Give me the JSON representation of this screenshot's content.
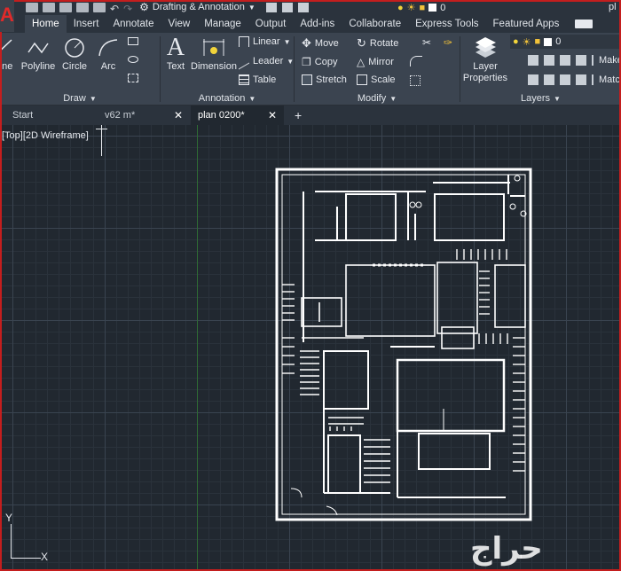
{
  "app": {
    "logo": "A"
  },
  "quick_access": {
    "workspace": "Drafting & Annotation",
    "layer_value": "0",
    "search_abbrev": "pl"
  },
  "ribbon_tabs": [
    "Home",
    "Insert",
    "Annotate",
    "View",
    "Manage",
    "Output",
    "Add-ins",
    "Collaborate",
    "Express Tools",
    "Featured Apps"
  ],
  "panels": {
    "draw": {
      "title": "Draw",
      "tools": [
        "Line",
        "Polyline",
        "Circle",
        "Arc"
      ]
    },
    "annotation": {
      "title": "Annotation",
      "tools": [
        "Text",
        "Dimension"
      ],
      "small": [
        "Linear",
        "Leader",
        "Table"
      ]
    },
    "modify": {
      "title": "Modify",
      "col1": [
        "Move",
        "Copy",
        "Stretch"
      ],
      "col2": [
        "Rotate",
        "Mirror",
        "Scale"
      ]
    },
    "layers": {
      "title": "Layers",
      "tool": "Layer Properties",
      "layer_name": "0",
      "small": [
        "Make",
        "Match"
      ]
    }
  },
  "document_tabs": [
    "Start",
    "v62 m*",
    "plan 0200*"
  ],
  "viewport": {
    "label": "[Top][2D Wireframe]"
  },
  "axis": {
    "y": "Y",
    "x": "X"
  },
  "watermark": "حراج",
  "colors": {
    "background": "#212830",
    "ribbon": "#3b4450",
    "tabbar": "#2b333d",
    "accent_red": "#c41e1e",
    "lines": "#ffffff",
    "grid": "#3a4450"
  }
}
